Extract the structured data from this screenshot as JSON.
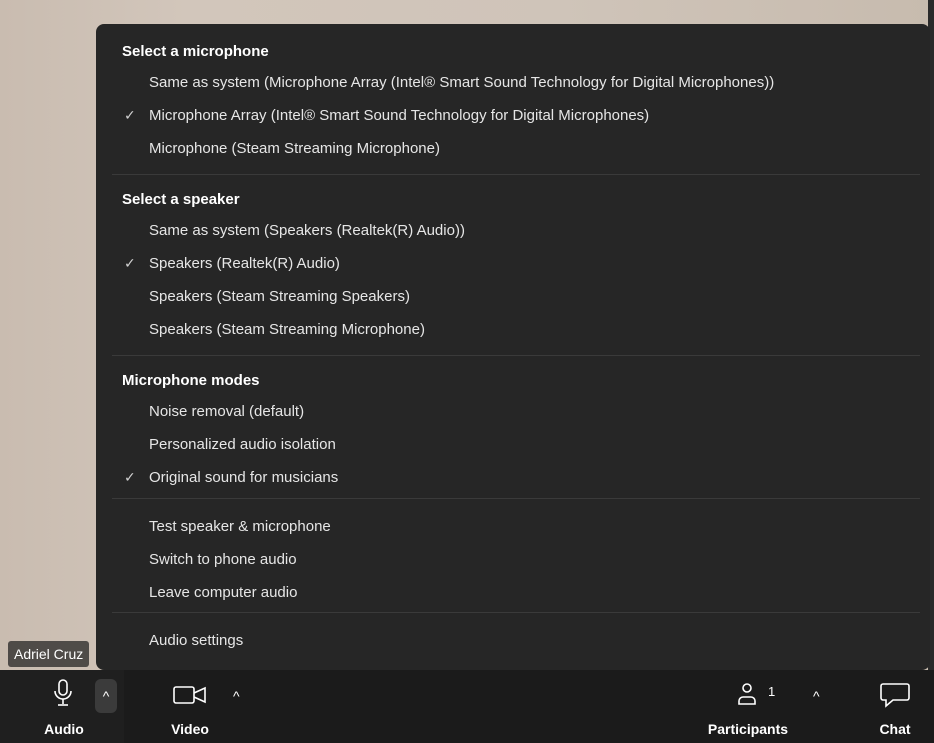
{
  "participant_name": "Adriel Cruz",
  "sections": [
    {
      "title": "Select a microphone",
      "items": [
        {
          "label": "Same as system (Microphone Array (Intel® Smart Sound Technology for Digital Microphones))",
          "checked": false
        },
        {
          "label": "Microphone Array (Intel® Smart Sound Technology for Digital Microphones)",
          "checked": true
        },
        {
          "label": "Microphone (Steam Streaming Microphone)",
          "checked": false
        }
      ]
    },
    {
      "title": "Select a speaker",
      "items": [
        {
          "label": "Same as system (Speakers (Realtek(R) Audio))",
          "checked": false
        },
        {
          "label": "Speakers (Realtek(R) Audio)",
          "checked": true
        },
        {
          "label": "Speakers (Steam Streaming Speakers)",
          "checked": false
        },
        {
          "label": "Speakers (Steam Streaming Microphone)",
          "checked": false
        }
      ]
    },
    {
      "title": "Microphone modes",
      "items": [
        {
          "label": "Noise removal (default)",
          "checked": false
        },
        {
          "label": "Personalized audio isolation",
          "checked": false
        },
        {
          "label": "Original sound for musicians",
          "checked": true
        }
      ]
    }
  ],
  "actions": [
    "Test speaker & microphone",
    "Switch to phone audio",
    "Leave computer audio"
  ],
  "settings_label": "Audio settings",
  "check_glyph": "✓",
  "toolbar": {
    "audio_label": "Audio",
    "video_label": "Video",
    "participants_label": "Participants",
    "participants_count": "1",
    "chat_label": "Chat",
    "caret_glyph": "^"
  }
}
